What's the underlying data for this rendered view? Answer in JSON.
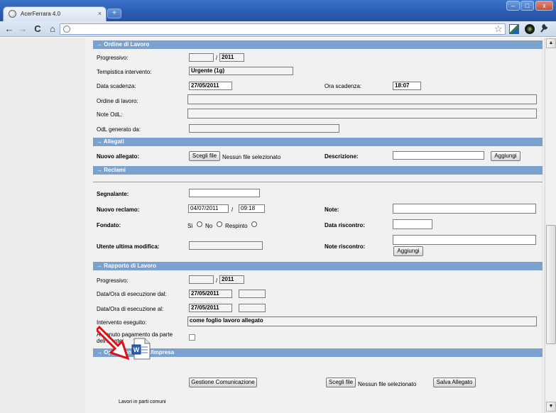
{
  "browser": {
    "tab_title": "AcerFerrara 4.0",
    "tab_close": "×",
    "new_tab": "+",
    "min": "–",
    "max": "□",
    "close": "x",
    "back": "←",
    "forward": "→",
    "reload": "C",
    "home": "⌂",
    "star": "☆",
    "wrench": "🔧"
  },
  "ordine": {
    "header": "→ Ordine di Lavoro",
    "progressivo_label": "Progressivo:",
    "progressivo_num": "",
    "slash": "/",
    "progressivo_year": "2011",
    "tempistica_label": "Tempistica intervento:",
    "tempistica_value": "Urgente (1g)",
    "data_scadenza_label": "Data scadenza:",
    "data_scadenza_value": "27/05/2011",
    "ora_scadenza_label": "Ora scadenza:",
    "ora_scadenza_value": "18:07",
    "ordine_label": "Ordine di lavoro:",
    "ordine_value": "",
    "note_label": "Note OdL:",
    "note_value": "",
    "generato_label": "OdL generato da:",
    "generato_value": ""
  },
  "allegati": {
    "header": "→ Allegati",
    "nuovo_label": "Nuovo allegato:",
    "choose_btn": "Scegli file",
    "no_file": "Nessun file selezionato",
    "descrizione_label": "Descrizione:",
    "descrizione_value": "",
    "aggiungi_btn": "Aggiungi"
  },
  "reclami": {
    "header": "→ Reclami",
    "segnalante_label": "Segnalante:",
    "segnalante_value": "",
    "nuovo_label": "Nuovo reclamo:",
    "nuovo_date": "04/07/2011",
    "slash": "/",
    "nuovo_time": "09:18",
    "note_label": "Note:",
    "note_value": "",
    "fondato_label": "Fondato:",
    "radio_si": "Si",
    "radio_no": "No",
    "radio_respinto": "Respinto",
    "data_riscontro_label": "Data riscontro:",
    "data_riscontro_value": "",
    "utente_label": "Utente ultima modifica:",
    "utente_value": "",
    "note_riscontro_label": "Note riscontro:",
    "note_riscontro_value": "",
    "aggiungi_btn": "Aggiungi"
  },
  "rapporto": {
    "header": "→ Rapporto di Lavoro",
    "progressivo_label": "Progressivo:",
    "progressivo_num": "",
    "slash": "/",
    "progressivo_year": "2011",
    "dal_label": "Data/Ora di esecuzione dal:",
    "dal_date": "27/05/2011",
    "dal_time": "",
    "al_label": "Data/Ora di esecuzione al:",
    "al_date": "27/05/2011",
    "al_time": "",
    "intervento_label": "Intervento eseguito:",
    "intervento_value": "come foglio lavoro allegato",
    "pagamento_label_1": "Avvenuto pagamento da parte",
    "pagamento_label_2": "dell'utente:",
    "pagamento_checked": false
  },
  "operazioni": {
    "header": "→ Operazioni ACER/Impresa",
    "doc_caption": "Lavori in parti comuni",
    "gestione_btn": "Gestione Comunicazione",
    "choose_btn": "Scegli file",
    "no_file": "Nessun file selezionato",
    "salva_btn": "Salva Allegato"
  },
  "colors": {
    "section_bg": "#7ba1ce",
    "panel_bg": "#f1f1f1",
    "titlebar": "#2a5bb0",
    "arrow_red": "#e01010"
  }
}
